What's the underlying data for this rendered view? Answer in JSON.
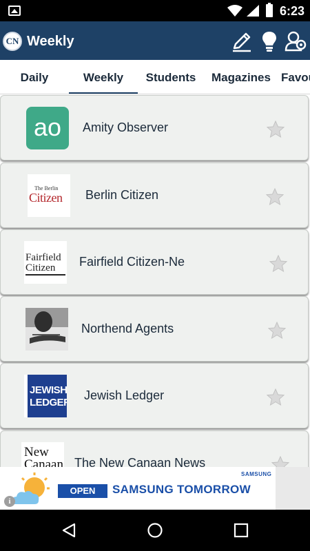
{
  "status_bar": {
    "time": "6:23"
  },
  "app_bar": {
    "logo_text": "CN",
    "title": "Weekly"
  },
  "tabs": [
    {
      "label": "Daily"
    },
    {
      "label": "Weekly"
    },
    {
      "label": "Students"
    },
    {
      "label": "Magazines"
    },
    {
      "label": "Favou"
    }
  ],
  "active_tab": "Weekly",
  "publications": [
    {
      "name": "Amity Observer",
      "logo_text": "ao",
      "favorite": false
    },
    {
      "name": "Berlin Citizen",
      "logo_text_small": "The Berlin",
      "logo_text_big": "Citizen",
      "favorite": false
    },
    {
      "name": "Fairfield Citizen-Ne",
      "logo_line1": "Fairfield",
      "logo_line2": "Citizen",
      "favorite": false
    },
    {
      "name": "Northend Agents",
      "favorite": false
    },
    {
      "name": "Jewish Ledger",
      "logo_line1": "JEWISH",
      "logo_line2": "LEDGER",
      "favorite": false
    },
    {
      "name": "The New Canaan News",
      "logo_line1": "New",
      "logo_line2": "Canaan",
      "favorite": false
    }
  ],
  "ad": {
    "brand_logo": "SAMSUNG",
    "button_label": "OPEN",
    "headline": "SAMSUNG TOMORROW",
    "info_icon": "i"
  },
  "colors": {
    "app_bar": "#1e4166",
    "card_bg": "#eff1ef",
    "ad_blue": "#1a4fa8"
  }
}
